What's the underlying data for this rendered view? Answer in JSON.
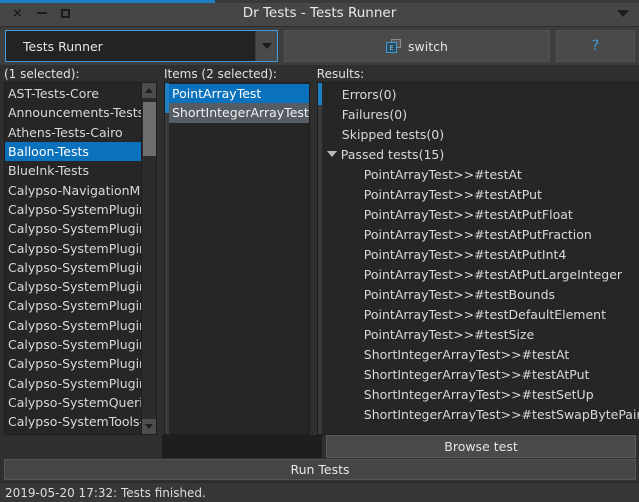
{
  "window": {
    "title": "Dr Tests - Tests Runner",
    "controls": {
      "close": "×",
      "minimize": "−",
      "maximize": "□"
    },
    "menu_arrow_icon": "caret-down"
  },
  "toolbar": {
    "combo_value": "Tests Runner",
    "combo_arrow_icon": "chevron-down",
    "switch_label": "switch",
    "switch_icon": "window-switch-icon",
    "help_label": "?"
  },
  "panes": {
    "left": {
      "header": "(1 selected):",
      "items": [
        {
          "label": "AST-Tests-Core",
          "state": "normal"
        },
        {
          "label": "Announcements-Tests-Cor",
          "state": "normal"
        },
        {
          "label": "Athens-Tests-Cairo",
          "state": "normal"
        },
        {
          "label": "Balloon-Tests",
          "state": "selected"
        },
        {
          "label": "BlueInk-Tests",
          "state": "normal"
        },
        {
          "label": "Calypso-NavigationModel-",
          "state": "normal"
        },
        {
          "label": "Calypso-SystemPlugins-Cr",
          "state": "normal"
        },
        {
          "label": "Calypso-SystemPlugins-De",
          "state": "normal"
        },
        {
          "label": "Calypso-SystemPlugins-FF",
          "state": "normal"
        },
        {
          "label": "Calypso-SystemPlugins-Flɑ",
          "state": "normal"
        },
        {
          "label": "Calypso-SystemPlugins-In",
          "state": "normal"
        },
        {
          "label": "Calypso-SystemPlugins-Re",
          "state": "normal"
        },
        {
          "label": "Calypso-SystemPlugins-Re",
          "state": "normal"
        },
        {
          "label": "Calypso-SystemPlugins-SU",
          "state": "normal"
        },
        {
          "label": "Calypso-SystemPlugins-Tr",
          "state": "normal"
        },
        {
          "label": "Calypso-SystemPlugins-Ur",
          "state": "normal"
        },
        {
          "label": "Calypso-SystemQueries-Te",
          "state": "normal"
        },
        {
          "label": "Calypso-SystemTools-FullI",
          "state": "normal"
        }
      ]
    },
    "middle": {
      "header": "Items (2 selected):",
      "items": [
        {
          "label": "PointArrayTest",
          "state": "selected"
        },
        {
          "label": "ShortIntegerArrayTest",
          "state": "secondary"
        }
      ]
    },
    "right": {
      "header": "Results:",
      "tree": [
        {
          "label": "Errors(0)",
          "level": 0,
          "expandable": false
        },
        {
          "label": "Failures(0)",
          "level": 0,
          "expandable": false
        },
        {
          "label": "Skipped tests(0)",
          "level": 0,
          "expandable": false
        },
        {
          "label": "Passed tests(15)",
          "level": 0,
          "expandable": true,
          "expanded": true
        },
        {
          "label": "PointArrayTest>>#testAt",
          "level": 1,
          "expandable": false
        },
        {
          "label": "PointArrayTest>>#testAtPut",
          "level": 1,
          "expandable": false
        },
        {
          "label": "PointArrayTest>>#testAtPutFloat",
          "level": 1,
          "expandable": false
        },
        {
          "label": "PointArrayTest>>#testAtPutFraction",
          "level": 1,
          "expandable": false
        },
        {
          "label": "PointArrayTest>>#testAtPutInt4",
          "level": 1,
          "expandable": false
        },
        {
          "label": "PointArrayTest>>#testAtPutLargeInteger",
          "level": 1,
          "expandable": false
        },
        {
          "label": "PointArrayTest>>#testBounds",
          "level": 1,
          "expandable": false
        },
        {
          "label": "PointArrayTest>>#testDefaultElement",
          "level": 1,
          "expandable": false
        },
        {
          "label": "PointArrayTest>>#testSize",
          "level": 1,
          "expandable": false
        },
        {
          "label": "ShortIntegerArrayTest>>#testAt",
          "level": 1,
          "expandable": false
        },
        {
          "label": "ShortIntegerArrayTest>>#testAtPut",
          "level": 1,
          "expandable": false
        },
        {
          "label": "ShortIntegerArrayTest>>#testSetUp",
          "level": 1,
          "expandable": false
        },
        {
          "label": "ShortIntegerArrayTest>>#testSwapBytePairs",
          "level": 1,
          "expandable": false
        }
      ]
    }
  },
  "buttons": {
    "browse_test": "Browse test",
    "run_tests": "Run Tests"
  },
  "statusbar": {
    "message": "2019-05-20 17:32: Tests finished."
  },
  "colors": {
    "accent": "#1f7fc4",
    "selection": "#0a71bd",
    "secondary_selection": "#555c63",
    "window_bg": "#2f2f2f",
    "list_bg": "#262626",
    "titlebar_bg": "#464646",
    "link": "#3f9ad8"
  }
}
